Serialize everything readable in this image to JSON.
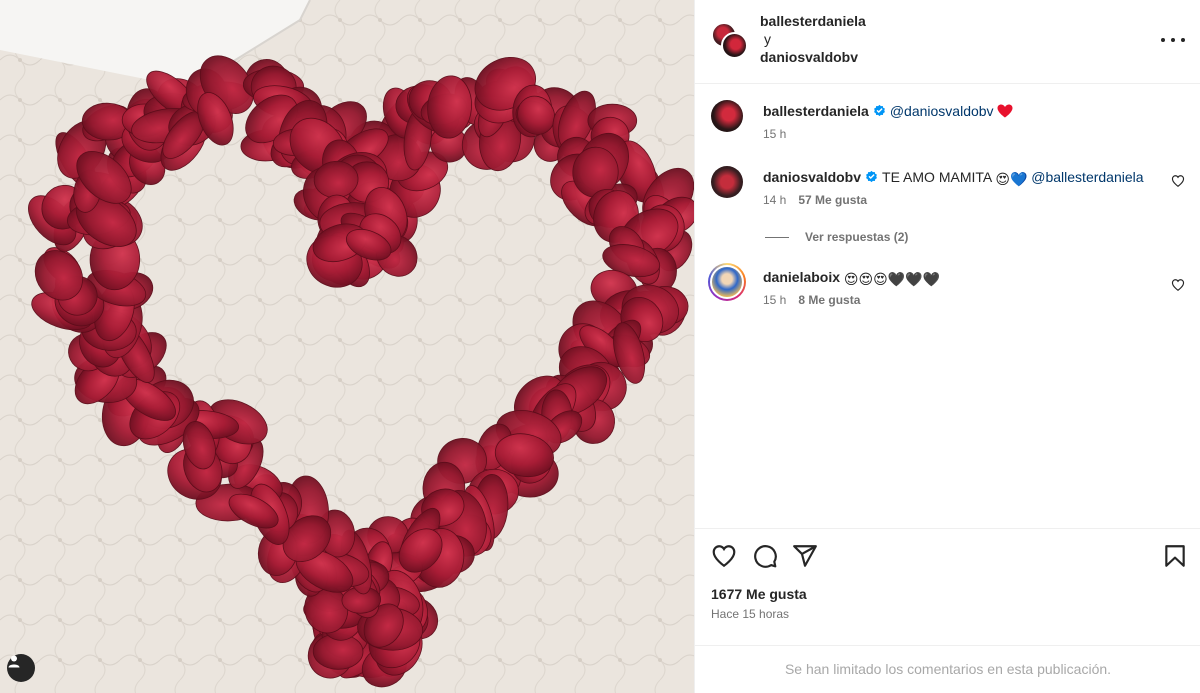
{
  "header": {
    "user1": "ballesterdaniela",
    "conjunction": "y",
    "user2": "daniosvaldobv"
  },
  "caption": {
    "username": "ballesterdaniela",
    "mention": "@daniosvaldobv",
    "emoji": "❤️",
    "time": "15 h"
  },
  "comments": [
    {
      "username": "daniosvaldobv",
      "text": "TE AMO MAMITA",
      "emojis": "😍💙",
      "mention": "@ballesterdaniela",
      "time": "14 h",
      "likes": "57 Me gusta",
      "replies_label": "Ver respuestas (2)"
    },
    {
      "username": "danielaboix",
      "emojis": "😍😍😍🖤🖤🖤",
      "time": "15 h",
      "likes": "8 Me gusta"
    }
  ],
  "footer": {
    "likes": "1677 Me gusta",
    "time_ago": "Hace 15 horas",
    "comments_limited": "Se han limitado los comentarios en esta publicación."
  },
  "icons": {
    "like": "heart-icon",
    "comment": "comment-icon",
    "share": "paper-plane-icon",
    "save": "bookmark-icon",
    "more": "more-options-icon",
    "tags": "user-tag-icon",
    "verified": "verified-badge-icon"
  },
  "colors": {
    "mention": "#00376b",
    "verified": "#0095f6",
    "petal": "#b0213a",
    "muted": "#737373"
  }
}
